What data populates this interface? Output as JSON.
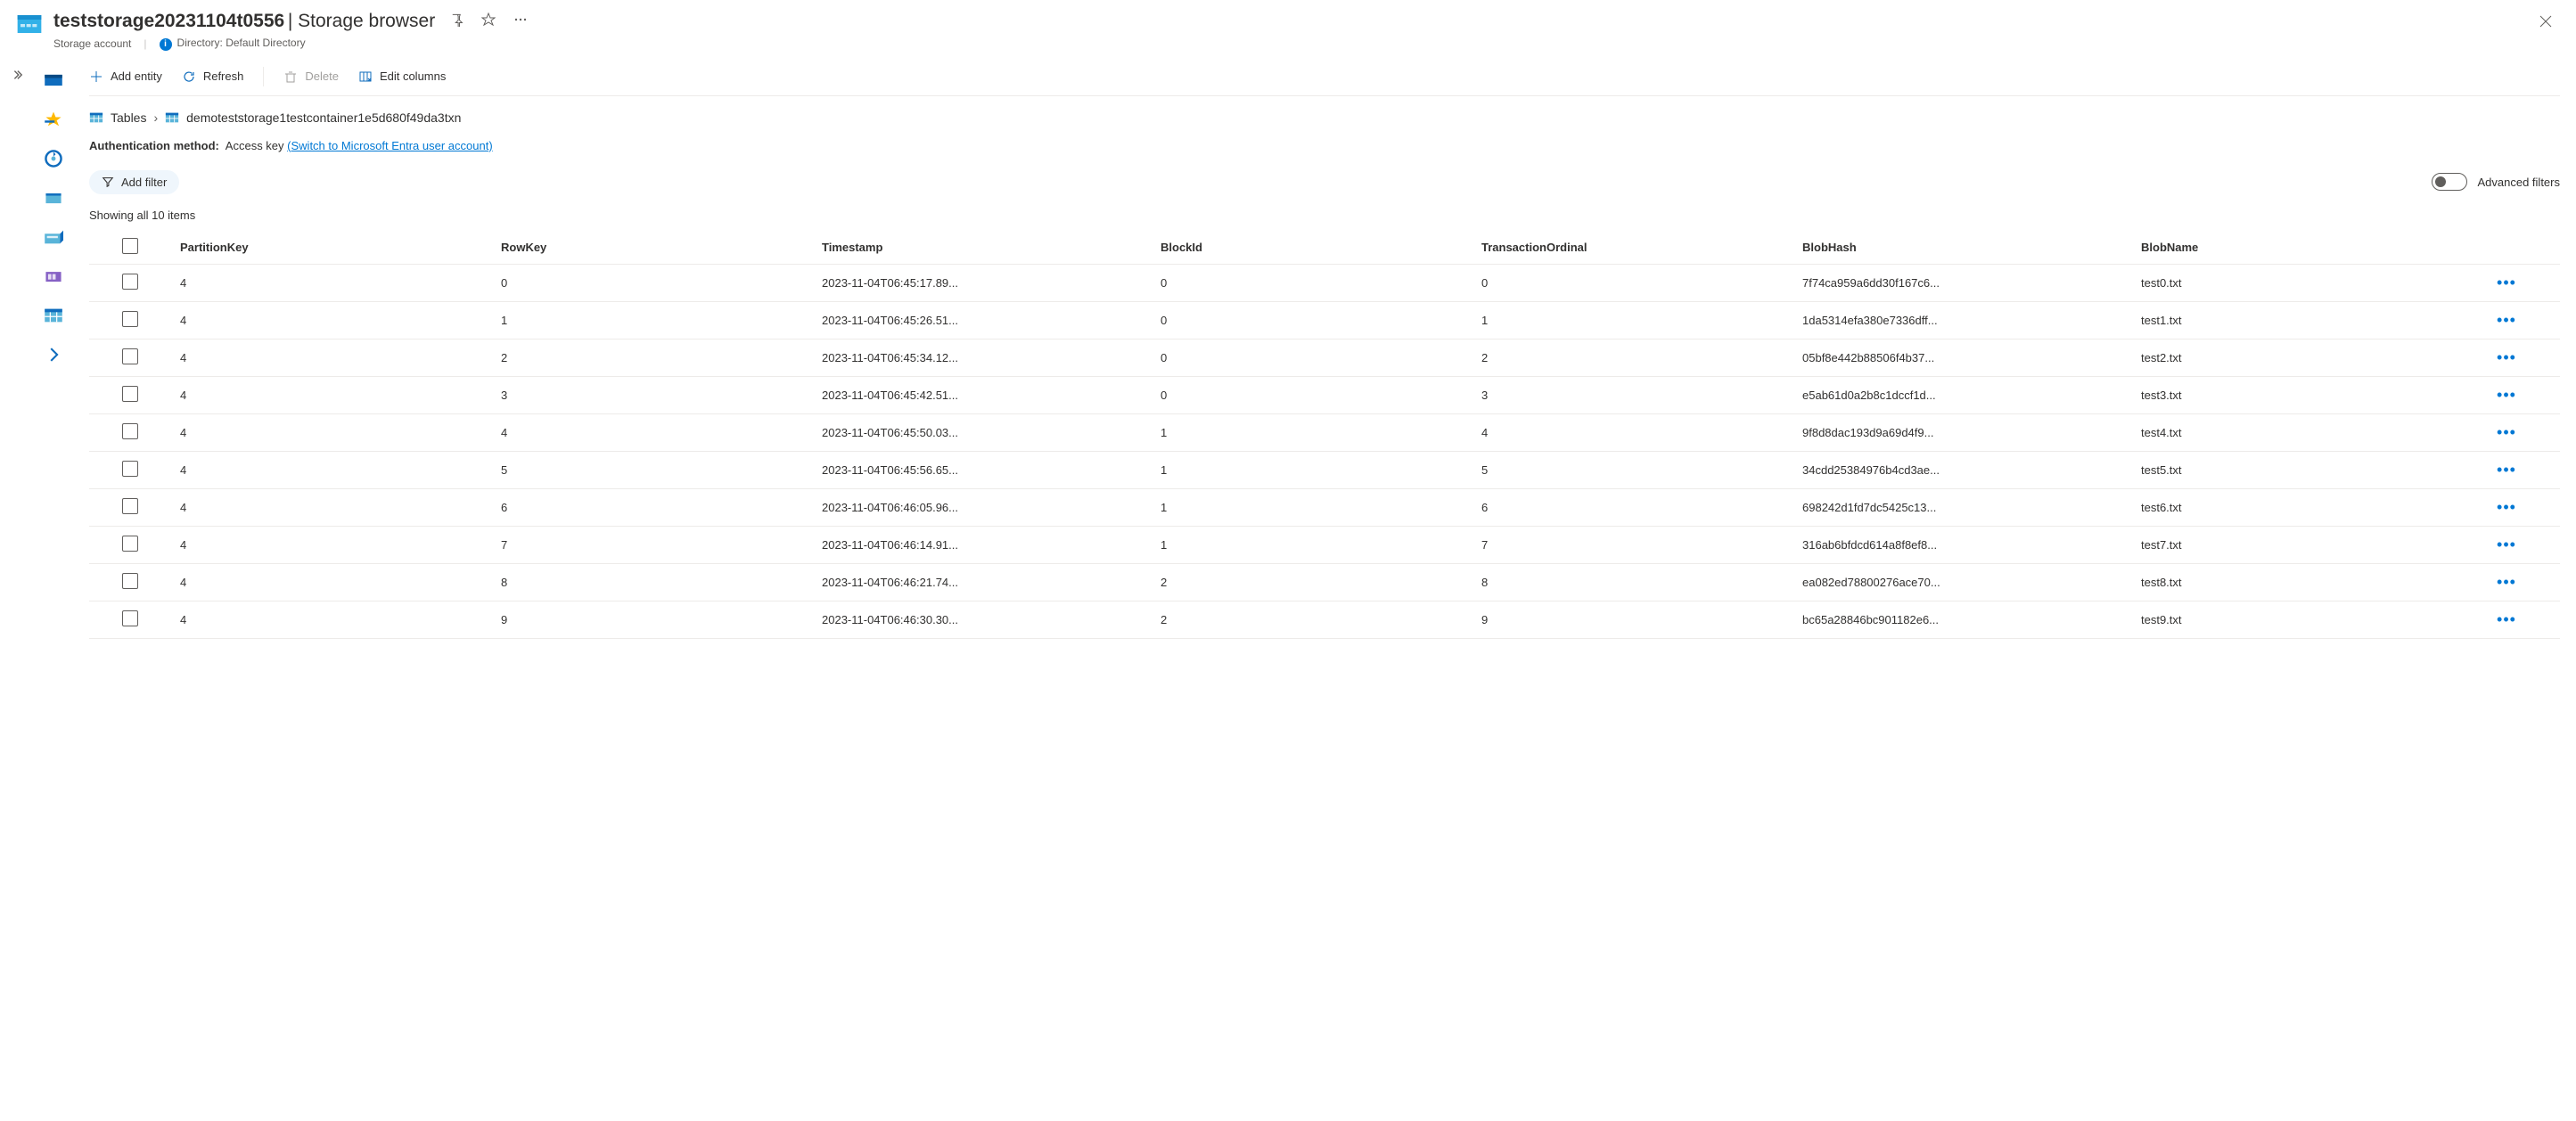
{
  "header": {
    "resource_name": "teststorage20231104t0556",
    "section_title": "Storage browser",
    "subtitle_type": "Storage account",
    "directory_label": "Directory: Default Directory"
  },
  "commands": {
    "add_entity": "Add entity",
    "refresh": "Refresh",
    "delete": "Delete",
    "edit_columns": "Edit columns"
  },
  "breadcrumb": {
    "root": "Tables",
    "current": "demoteststorage1testcontainer1e5d680f49da3txn"
  },
  "auth": {
    "label": "Authentication method:",
    "value": "Access key",
    "switch_link": "(Switch to Microsoft Entra user account)"
  },
  "filter": {
    "add_filter": "Add filter",
    "advanced_filters": "Advanced filters"
  },
  "count_text": "Showing all 10 items",
  "columns": [
    "PartitionKey",
    "RowKey",
    "Timestamp",
    "BlockId",
    "TransactionOrdinal",
    "BlobHash",
    "BlobName"
  ],
  "rows": [
    {
      "pk": "4",
      "rk": "0",
      "ts": "2023-11-04T06:45:17.89...",
      "blockid": "0",
      "to": "0",
      "hash": "7f74ca959a6dd30f167c6...",
      "name": "test0.txt"
    },
    {
      "pk": "4",
      "rk": "1",
      "ts": "2023-11-04T06:45:26.51...",
      "blockid": "0",
      "to": "1",
      "hash": "1da5314efa380e7336dff...",
      "name": "test1.txt"
    },
    {
      "pk": "4",
      "rk": "2",
      "ts": "2023-11-04T06:45:34.12...",
      "blockid": "0",
      "to": "2",
      "hash": "05bf8e442b88506f4b37...",
      "name": "test2.txt"
    },
    {
      "pk": "4",
      "rk": "3",
      "ts": "2023-11-04T06:45:42.51...",
      "blockid": "0",
      "to": "3",
      "hash": "e5ab61d0a2b8c1dccf1d...",
      "name": "test3.txt"
    },
    {
      "pk": "4",
      "rk": "4",
      "ts": "2023-11-04T06:45:50.03...",
      "blockid": "1",
      "to": "4",
      "hash": "9f8d8dac193d9a69d4f9...",
      "name": "test4.txt"
    },
    {
      "pk": "4",
      "rk": "5",
      "ts": "2023-11-04T06:45:56.65...",
      "blockid": "1",
      "to": "5",
      "hash": "34cdd25384976b4cd3ae...",
      "name": "test5.txt"
    },
    {
      "pk": "4",
      "rk": "6",
      "ts": "2023-11-04T06:46:05.96...",
      "blockid": "1",
      "to": "6",
      "hash": "698242d1fd7dc5425c13...",
      "name": "test6.txt"
    },
    {
      "pk": "4",
      "rk": "7",
      "ts": "2023-11-04T06:46:14.91...",
      "blockid": "1",
      "to": "7",
      "hash": "316ab6bfdcd614a8f8ef8...",
      "name": "test7.txt"
    },
    {
      "pk": "4",
      "rk": "8",
      "ts": "2023-11-04T06:46:21.74...",
      "blockid": "2",
      "to": "8",
      "hash": "ea082ed78800276ace70...",
      "name": "test8.txt"
    },
    {
      "pk": "4",
      "rk": "9",
      "ts": "2023-11-04T06:46:30.30...",
      "blockid": "2",
      "to": "9",
      "hash": "bc65a28846bc901182e6...",
      "name": "test9.txt"
    }
  ]
}
